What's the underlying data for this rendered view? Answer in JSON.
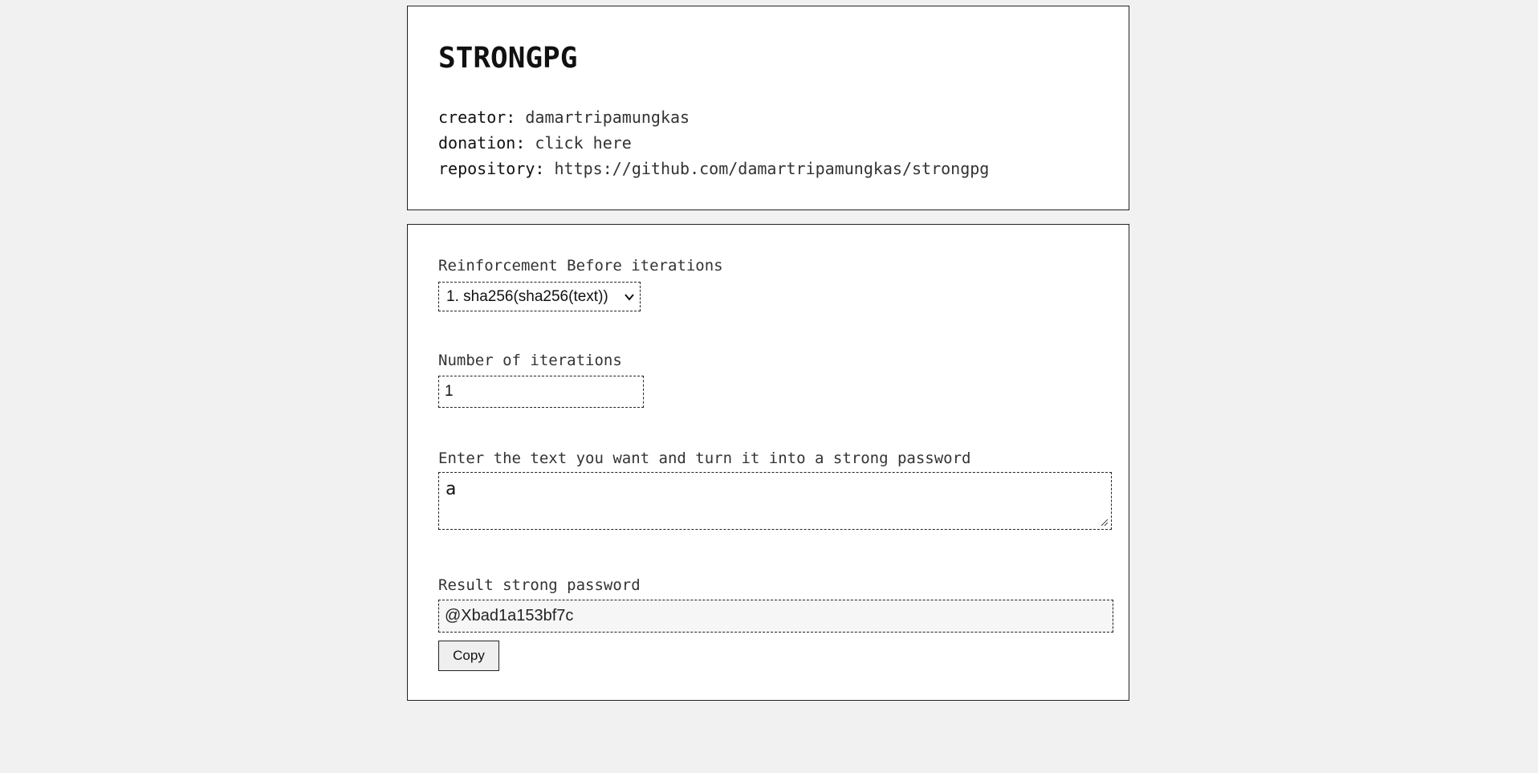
{
  "header": {
    "title": "STRONGPG",
    "creator_key": "creator:",
    "creator_value": "damartripamungkas",
    "donation_key": "donation:",
    "donation_value": "click here",
    "repository_key": "repository:",
    "repository_value": "https://github.com/damartripamungkas/strongpg"
  },
  "form": {
    "reinforcement": {
      "label": "Reinforcement Before iterations",
      "selected": "1. sha256(sha256(text))"
    },
    "iterations": {
      "label": "Number of iterations",
      "value": "1"
    },
    "text": {
      "label": "Enter the text you want and turn it into a strong password",
      "value": "a"
    },
    "result": {
      "label": "Result strong password",
      "value": "@Xbad1a153bf7c"
    },
    "copy_label": "Copy"
  },
  "icons": {
    "select_chevron": "chevron-down-icon",
    "textarea_grip": "resize-grip-icon"
  },
  "colors": {
    "page_background": "#f1f1f1",
    "card_background": "#ffffff",
    "border": "#222222",
    "result_background": "#f6f6f6"
  }
}
